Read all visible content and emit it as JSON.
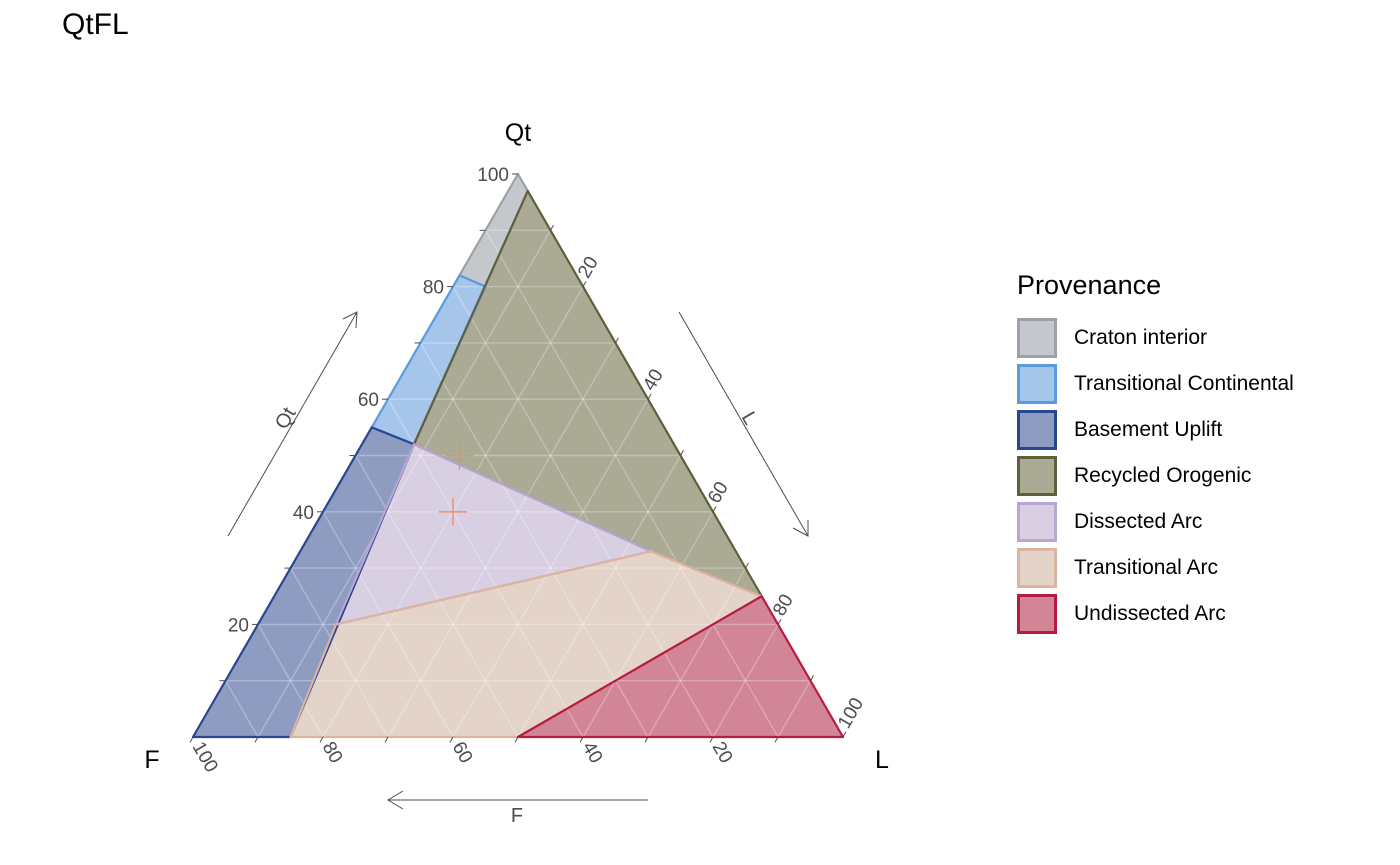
{
  "chart_data": {
    "type": "ternary",
    "title": "QtFL",
    "vertices": {
      "top": "Qt",
      "left": "F",
      "right": "L"
    },
    "axis_arrows": {
      "qt": "Qt",
      "l": "L",
      "f": "F"
    },
    "ticks": [
      20,
      40,
      60,
      80,
      100
    ],
    "tick_labels": [
      "20",
      "40",
      "60",
      "80",
      "100"
    ],
    "minor_step": 10,
    "grid": true,
    "legend": {
      "title": "Provenance",
      "position": "right"
    },
    "regions": [
      {
        "name": "Craton interior",
        "fill": "#c4c7cc",
        "stroke": "#9da1a6",
        "points": [
          [
            100,
            0,
            0
          ],
          [
            97,
            0,
            3
          ],
          [
            80,
            15,
            5
          ],
          [
            82,
            18,
            0
          ]
        ]
      },
      {
        "name": "Transitional Continental",
        "fill": "#a5c6ea",
        "stroke": "#5a9be0",
        "points": [
          [
            82,
            18,
            0
          ],
          [
            80,
            15,
            5
          ],
          [
            52,
            40,
            8
          ],
          [
            55,
            45,
            0
          ]
        ]
      },
      {
        "name": "Basement Uplift",
        "fill": "#8f9cc2",
        "stroke": "#2b4691",
        "points": [
          [
            55,
            45,
            0
          ],
          [
            52,
            40,
            8
          ],
          [
            0,
            85,
            15
          ],
          [
            0,
            100,
            0
          ]
        ]
      },
      {
        "name": "Recycled Orogenic",
        "fill": "#aaaa95",
        "stroke": "#5f5f3c",
        "points": [
          [
            97,
            0,
            3
          ],
          [
            25,
            0,
            75
          ],
          [
            33,
            13,
            54
          ],
          [
            52,
            40,
            8
          ]
        ]
      },
      {
        "name": "Dissected Arc",
        "fill": "#d8cfe2",
        "stroke": "#b9a7d2",
        "points": [
          [
            52,
            40,
            8
          ],
          [
            33,
            13,
            54
          ],
          [
            20,
            68,
            12
          ]
        ]
      },
      {
        "name": "Transitional Arc",
        "fill": "#e4d3c8",
        "stroke": "#dcb4a0",
        "points": [
          [
            20,
            68,
            12
          ],
          [
            33,
            13,
            54
          ],
          [
            25,
            0,
            75
          ],
          [
            0,
            50,
            50
          ],
          [
            0,
            85,
            15
          ]
        ]
      },
      {
        "name": "Undissected Arc",
        "fill": "#d28596",
        "stroke": "#b71c40",
        "points": [
          [
            0,
            50,
            50
          ],
          [
            25,
            0,
            75
          ],
          [
            0,
            0,
            100
          ]
        ]
      }
    ],
    "points": [
      {
        "Qt": 50,
        "F": 34,
        "L": 16,
        "marker": "+",
        "color": "#f4875f"
      },
      {
        "Qt": 40,
        "F": 40,
        "L": 20,
        "marker": "+",
        "color": "#f4875f"
      }
    ]
  }
}
